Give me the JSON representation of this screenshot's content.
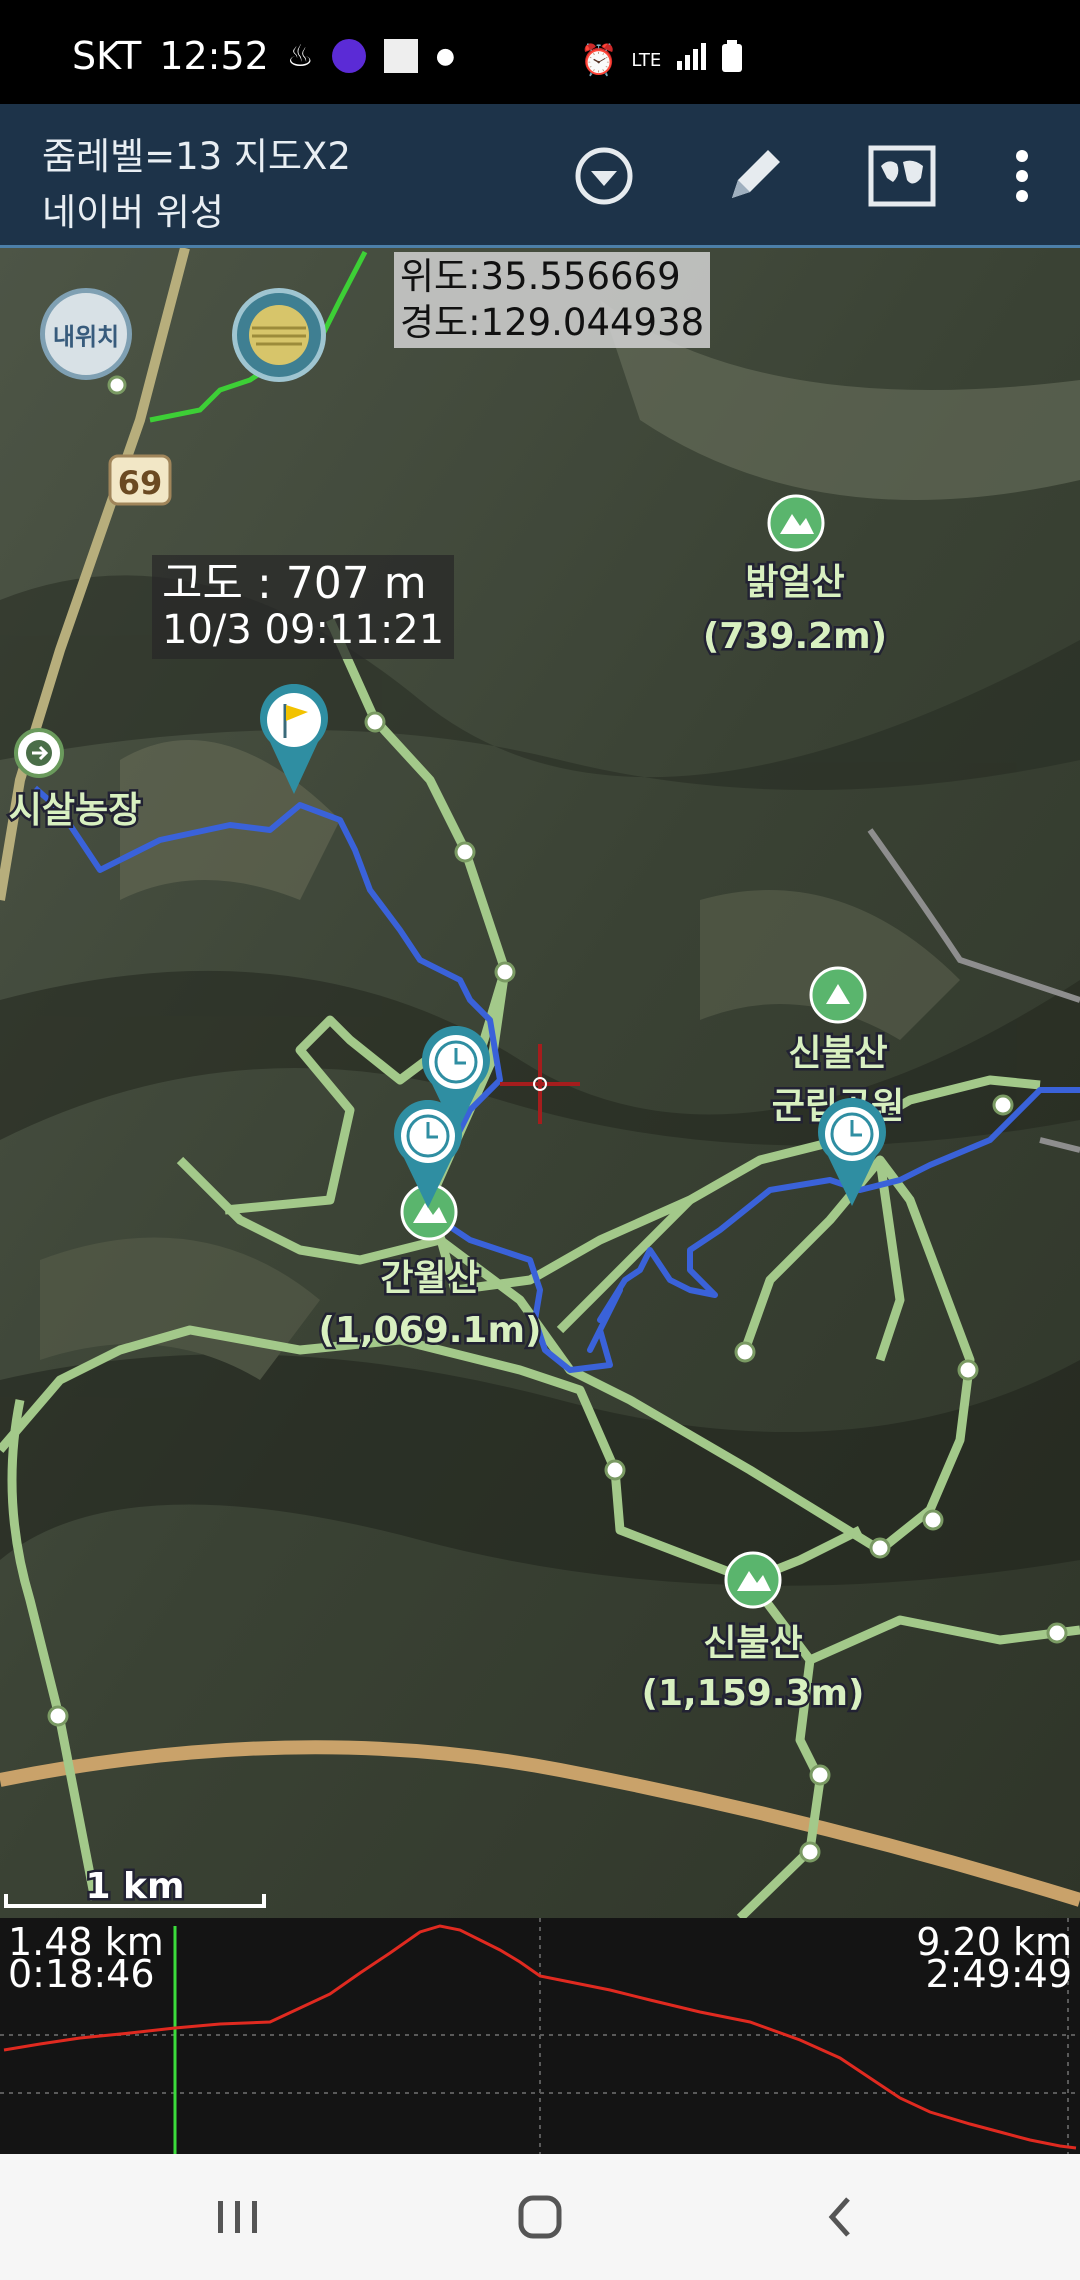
{
  "status_bar": {
    "carrier": "SKT",
    "time": "12:52",
    "network": "LTE"
  },
  "app_bar": {
    "line1": "줌레벨=13 지도X2",
    "line2": "네이버 위성",
    "icons": [
      "dropdown-circle-icon",
      "pencil-icon",
      "world-map-icon",
      "more-vert-icon"
    ]
  },
  "map": {
    "coords": {
      "lat": "위도:35.556669",
      "lon": "경도:129.044938"
    },
    "my_location_label": "내위치",
    "route_number": "69",
    "altitude_tooltip": {
      "altitude": "고도 : 707 m",
      "timestamp": "10/3 09:11:21"
    },
    "places": [
      {
        "name": "밝얼산",
        "elevation": "(739.2m)"
      },
      {
        "name": "신불산",
        "elevation": "군립공원"
      },
      {
        "name": "간월산",
        "elevation": "(1,069.1m)"
      },
      {
        "name": "신불산",
        "elevation": "(1,159.3m)"
      },
      {
        "name": "시살농장",
        "elevation": ""
      }
    ],
    "scale_label": "1 km",
    "track_color": "#3a62d9",
    "trail_color": "#a3c98a"
  },
  "profile": {
    "current_distance": "1.48 km",
    "current_time": "0:18:46",
    "total_distance": "9.20 km",
    "total_time": "2:49:49",
    "line_color": "#e02a20",
    "marker_color": "#3bdc3b"
  },
  "nav_bar": {
    "icons": [
      "recent-apps-icon",
      "home-icon",
      "back-icon"
    ]
  }
}
